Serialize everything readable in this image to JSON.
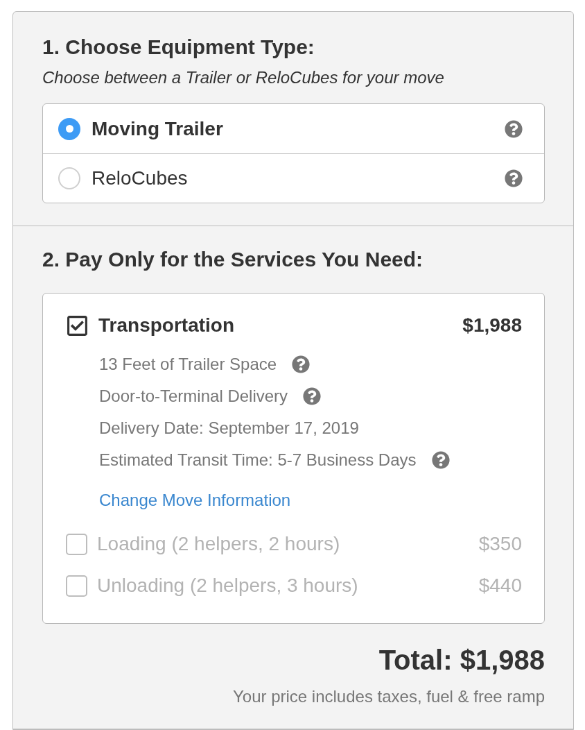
{
  "section_1": {
    "title": "1. Choose Equipment Type:",
    "subtitle": "Choose between a Trailer or ReloCubes for your move",
    "options": [
      {
        "label": "Moving Trailer",
        "selected": true,
        "help": true
      },
      {
        "label": "ReloCubes",
        "selected": false,
        "help": true
      }
    ]
  },
  "section_2": {
    "title": "2. Pay Only for the Services You Need:",
    "services": [
      {
        "label": "Transportation",
        "price": "$1,988",
        "checked": true,
        "details": [
          {
            "text": "13 Feet of Trailer Space",
            "help": true
          },
          {
            "text": "Door-to-Terminal Delivery",
            "help": true
          },
          {
            "text": "Delivery Date: September 17, 2019",
            "help": false
          },
          {
            "text": "Estimated Transit Time: 5-7 Business Days",
            "help": true
          }
        ],
        "link": "Change Move Information"
      },
      {
        "label": "Loading (2 helpers, 2 hours)",
        "price": "$350",
        "checked": false
      },
      {
        "label": "Unloading (2 helpers, 3 hours)",
        "price": "$440",
        "checked": false
      }
    ]
  },
  "total": {
    "label": "Total: $1,988",
    "note": "Your price includes taxes, fuel & free ramp"
  }
}
